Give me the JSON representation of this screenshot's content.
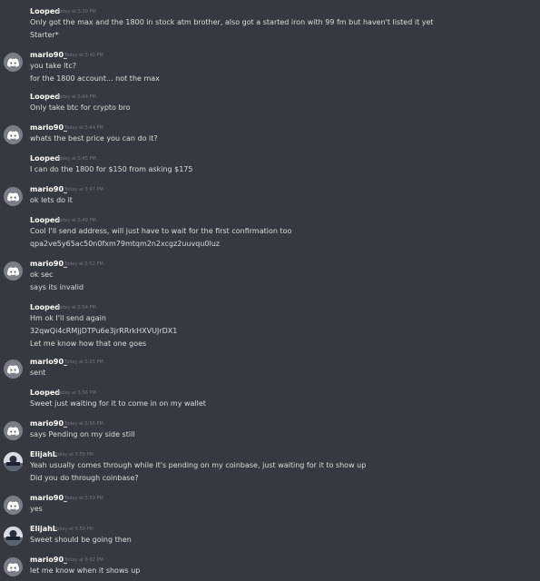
{
  "messages": [
    {
      "author": "Looped",
      "time": "Today at 5:39 PM",
      "avatar": "none",
      "lines": [
        "Only got the max and the 1800 in stock atm brother, also got a started iron with 99 fm but haven't listed it yet",
        "Starter*"
      ]
    },
    {
      "author": "mario90_",
      "time": "Today at 5:40 PM",
      "avatar": "discord-logo-icon",
      "lines": [
        "you take ltc?",
        "for the 1800 account... not the max"
      ]
    },
    {
      "author": "Looped",
      "time": "Today at 5:44 PM",
      "avatar": "none",
      "lines": [
        "Only take btc for crypto bro"
      ]
    },
    {
      "author": "mario90_",
      "time": "Today at 5:44 PM",
      "avatar": "discord-logo-icon",
      "lines": [
        "whats the best price you can do it?"
      ]
    },
    {
      "author": "Looped",
      "time": "Today at 5:45 PM",
      "avatar": "none",
      "lines": [
        "I can do the 1800 for $150 from asking $175"
      ]
    },
    {
      "author": "mario90_",
      "time": "Today at 5:47 PM",
      "avatar": "discord-logo-icon",
      "lines": [
        "ok lets do it"
      ]
    },
    {
      "author": "Looped",
      "time": "Today at 5:49 PM",
      "avatar": "none",
      "lines": [
        "Cool I'll send address, will just have to wait for the first confirmation too",
        "qpa2ve5y65ac50n0fxm79mtqm2n2xcgz2uuvqu0luz"
      ]
    },
    {
      "author": "mario90_",
      "time": "Today at 5:52 PM",
      "avatar": "discord-logo-icon",
      "lines": [
        "ok sec",
        "says its invalid"
      ]
    },
    {
      "author": "Looped",
      "time": "Today at 5:54 PM",
      "avatar": "none",
      "lines": [
        "Hm ok I'll send again",
        "32qwQi4cRMjjDTPu6e3jrRRrkHXVUJrDX1",
        "Let me know how that one goes"
      ]
    },
    {
      "author": "mario90_",
      "time": "Today at 5:55 PM",
      "avatar": "discord-logo-icon",
      "lines": [
        "sent"
      ]
    },
    {
      "author": "Looped",
      "time": "Today at 5:56 PM",
      "avatar": "none",
      "lines": [
        "Sweet just waiting for it to come in on my wallet"
      ]
    },
    {
      "author": "mario90_",
      "time": "Today at 5:56 PM",
      "avatar": "discord-logo-icon",
      "lines": [
        "says Pending on my side still"
      ]
    },
    {
      "author": "ElijahL",
      "time": "Today at 5:59 PM",
      "avatar": "profile-photo",
      "lines": [
        "Yeah usually comes through while it's pending on my coinbase, just waiting for it to show up",
        "Did you do through coinbase?"
      ]
    },
    {
      "author": "mario90_",
      "time": "Today at 5:59 PM",
      "avatar": "discord-logo-icon",
      "lines": [
        "yes"
      ]
    },
    {
      "author": "ElijahL",
      "time": "Today at 5:59 PM",
      "avatar": "profile-photo",
      "lines": [
        "Sweet should be going then"
      ]
    },
    {
      "author": "mario90_",
      "time": "Today at 6:02 PM",
      "avatar": "discord-logo-icon",
      "lines": [
        "let me know when it shows up"
      ]
    }
  ]
}
